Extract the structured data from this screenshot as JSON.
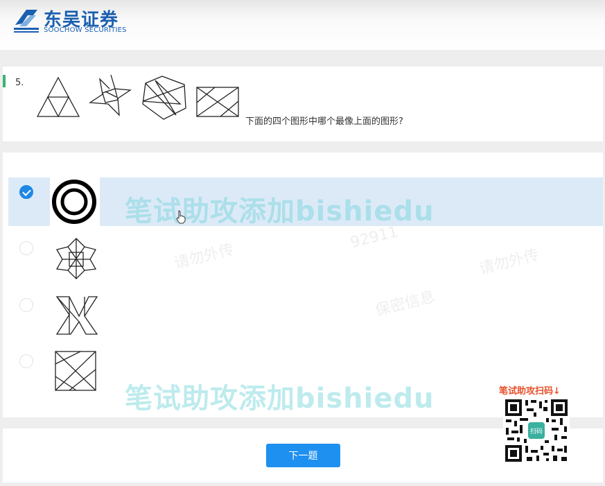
{
  "header": {
    "logo_cn": "东吴证券",
    "logo_en": "SOOCHOW SECURITIES"
  },
  "question": {
    "number": "5.",
    "text": "下面的四个图形中哪个最像上面的图形?",
    "figures": [
      "triangle-subdivided-icon",
      "four-point-star-icon",
      "pentagon-star-icon",
      "crossed-rectangle-icon"
    ]
  },
  "options": [
    {
      "id": "A",
      "selected": true,
      "figure": "concentric-circles-icon"
    },
    {
      "id": "B",
      "selected": false,
      "figure": "eight-point-star-icon"
    },
    {
      "id": "C",
      "selected": false,
      "figure": "zigzag-lines-icon"
    },
    {
      "id": "D",
      "selected": false,
      "figure": "crossed-square-icon"
    }
  ],
  "watermark": {
    "primary": "笔试助攻添加bishiedu",
    "faint": [
      "请勿外传",
      "保密信息",
      "92911"
    ]
  },
  "footer": {
    "next_label": "下一题"
  },
  "promo": {
    "qr_label": "笔试助攻扫码↓",
    "qr_center": "扫码"
  },
  "colors": {
    "accent": "#1e88e5",
    "brand": "#1a5fb0",
    "highlight": "#dceaf8",
    "watermark": "#6ed2d7",
    "promo": "#e8502a"
  }
}
